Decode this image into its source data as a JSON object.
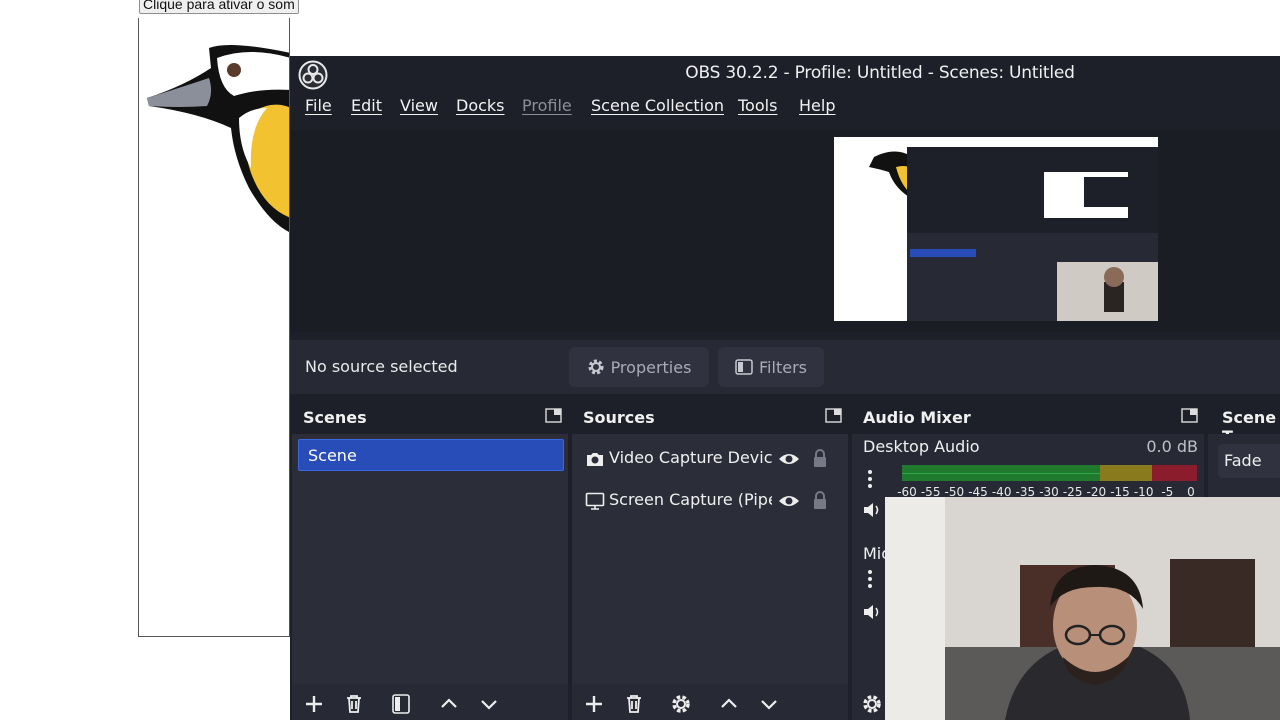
{
  "browser": {
    "unmute_button": "Clique para ativar o som"
  },
  "obs": {
    "window_title": "OBS 30.2.2 - Profile: Untitled - Scenes: Untitled",
    "menu": [
      "File",
      "Edit",
      "View",
      "Docks",
      "Profile",
      "Scene Collection",
      "Tools",
      "Help"
    ],
    "menu_disabled": "Profile",
    "source_bar": {
      "status": "No source selected",
      "properties": "Properties",
      "filters": "Filters"
    },
    "scenes": {
      "title": "Scenes",
      "items": [
        "Scene"
      ]
    },
    "sources": {
      "title": "Sources",
      "items": [
        {
          "label": "Video Capture Devic",
          "icon": "camera-icon"
        },
        {
          "label": "Screen Capture (Pipe",
          "icon": "monitor-icon"
        }
      ]
    },
    "audio_mixer": {
      "title": "Audio Mixer",
      "channels": [
        {
          "name": "Desktop Audio",
          "level": "0.0 dB"
        },
        {
          "name": "Mic",
          "level": ""
        }
      ],
      "meter_ticks": [
        "-60",
        "-55",
        "-50",
        "-45",
        "-40",
        "-35",
        "-30",
        "-25",
        "-20",
        "-15",
        "-10",
        "-5",
        "0"
      ]
    },
    "scene_transitions": {
      "title": "Scene T",
      "transition": "Fade"
    }
  }
}
